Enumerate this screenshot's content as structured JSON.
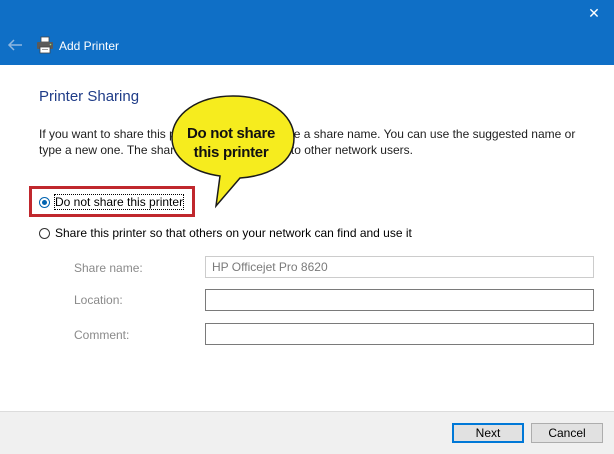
{
  "window": {
    "title": "Add Printer",
    "close_glyph": "✕"
  },
  "page": {
    "heading": "Printer Sharing",
    "description": "If you want to share this printer, you must provide a share name. You can use the suggested name or type a new one. The share name will be visible to other network users."
  },
  "options": [
    {
      "label": "Do not share this printer",
      "selected": true
    },
    {
      "label": "Share this printer so that others on your network can find and use it",
      "selected": false
    }
  ],
  "fields": {
    "share_name": {
      "label": "Share name:",
      "value": "HP Officejet Pro 8620"
    },
    "location": {
      "label": "Location:",
      "value": ""
    },
    "comment": {
      "label": "Comment:",
      "value": ""
    }
  },
  "buttons": {
    "next": "Next",
    "cancel": "Cancel"
  },
  "callout": {
    "text": "Do not share this printer"
  },
  "colors": {
    "titlebar": "#0f6fc6",
    "heading": "#1f3c88",
    "highlight": "#c0272d",
    "callout": "#f6ec1e"
  }
}
